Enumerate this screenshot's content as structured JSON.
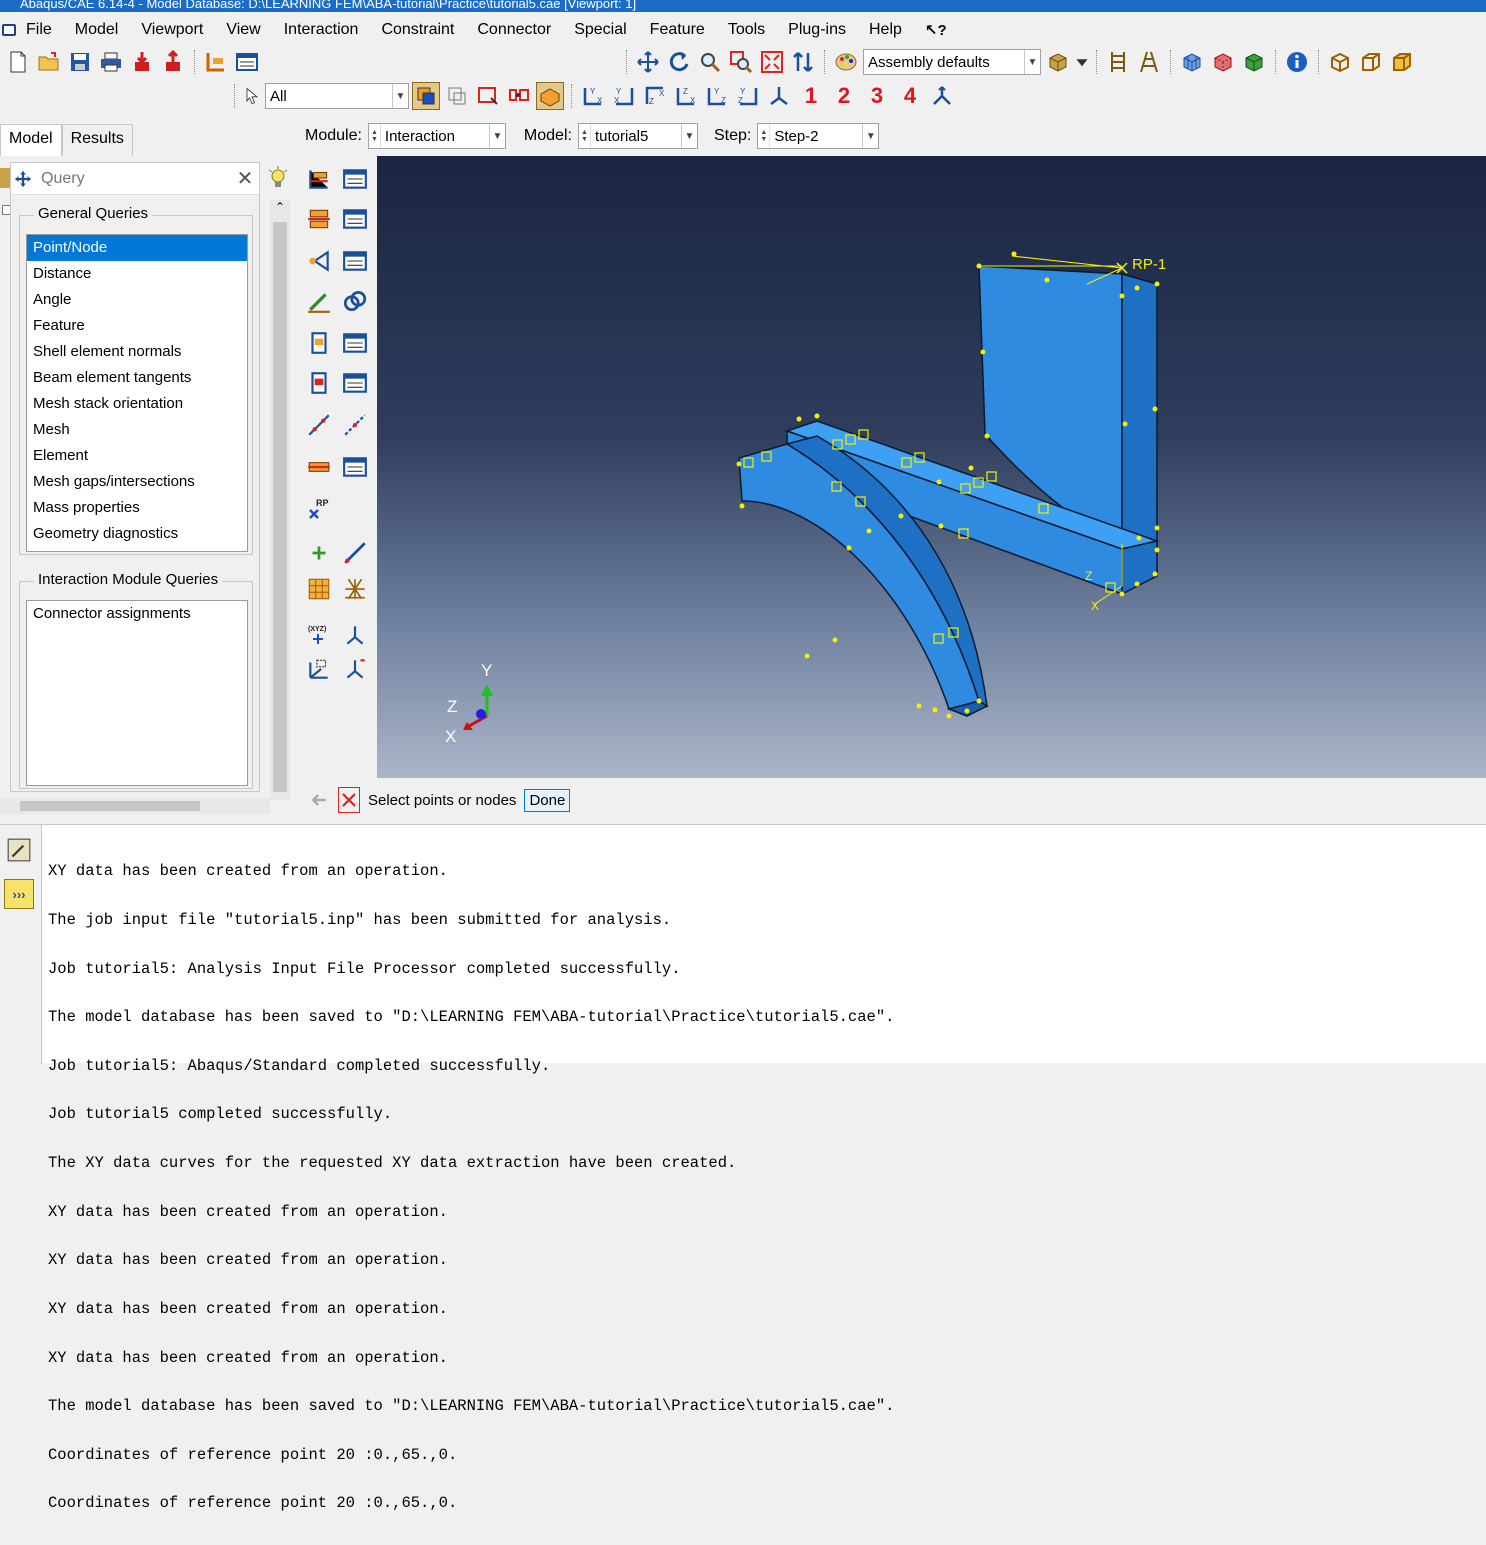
{
  "window": {
    "title": "Abaqus/CAE 6.14-4 - Model Database: D:\\LEARNING FEM\\ABA-tutorial\\Practice\\tutorial5.cae [Viewport: 1]"
  },
  "menubar": {
    "items": [
      "File",
      "Model",
      "Viewport",
      "View",
      "Interaction",
      "Constraint",
      "Connector",
      "Special",
      "Feature",
      "Tools",
      "Plug-ins",
      "Help",
      "↖?"
    ]
  },
  "toolbar": {
    "render_style": "Assembly defaults",
    "selection_filter": "All",
    "view_numbers": [
      "1",
      "2",
      "3",
      "4"
    ]
  },
  "tabs": {
    "model": "Model",
    "results": "Results"
  },
  "context": {
    "module_label": "Module:",
    "module_value": "Interaction",
    "model_label": "Model:",
    "model_value": "tutorial5",
    "step_label": "Step:",
    "step_value": "Step-2"
  },
  "query": {
    "title": "Query",
    "general_title": "General Queries",
    "general_items": [
      "Point/Node",
      "Distance",
      "Angle",
      "Feature",
      "Shell element normals",
      "Beam element tangents",
      "Mesh stack orientation",
      "Mesh",
      "Element",
      "Mesh gaps/intersections",
      "Mass properties",
      "Geometry diagnostics"
    ],
    "interaction_title": "Interaction Module Queries",
    "interaction_items": [
      "Connector assignments"
    ]
  },
  "viewport": {
    "ref_point_label": "RP-1",
    "triad": {
      "x": "X",
      "y": "Y",
      "z": "Z"
    },
    "local_csys": {
      "z": "Z",
      "x": "X"
    },
    "part_color": "#2e8be0",
    "background_top": "#1a2541",
    "background_bottom": "#aab5c8"
  },
  "toolbox": {
    "rp_label": "RP",
    "xyz_label": "(XYZ)"
  },
  "prompt": {
    "text": "Select points or nodes",
    "done_label": "Done"
  },
  "messages": [
    "XY data has been created from an operation.",
    "The job input file \"tutorial5.inp\" has been submitted for analysis.",
    "Job tutorial5: Analysis Input File Processor completed successfully.",
    "The model database has been saved to \"D:\\LEARNING FEM\\ABA-tutorial\\Practice\\tutorial5.cae\".",
    "Job tutorial5: Abaqus/Standard completed successfully.",
    "Job tutorial5 completed successfully.",
    "The XY data curves for the requested XY data extraction have been created.",
    "XY data has been created from an operation.",
    "XY data has been created from an operation.",
    "XY data has been created from an operation.",
    "XY data has been created from an operation.",
    "The model database has been saved to \"D:\\LEARNING FEM\\ABA-tutorial\\Practice\\tutorial5.cae\".",
    "Coordinates of reference point 20 :0.,65.,0.",
    "Coordinates of reference point 20 :0.,65.,0."
  ]
}
